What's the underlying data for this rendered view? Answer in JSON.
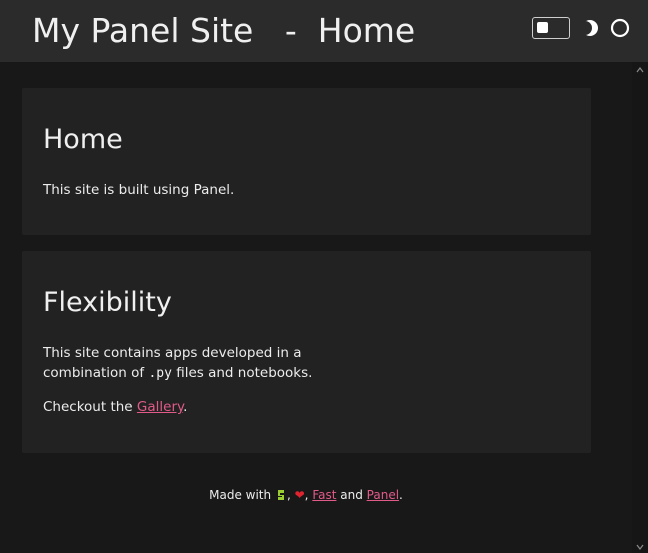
{
  "header": {
    "site_title": "My Panel Site",
    "separator": "-",
    "page_name": "Home"
  },
  "icons": {
    "theme_toggle": "toggle-switch",
    "dark_mode": "moon-icon",
    "light_mode": "sun-icon",
    "python": "python-snake-icon",
    "heart": "heart-icon"
  },
  "cards": [
    {
      "title": "Home",
      "body": "This site is built using Panel."
    },
    {
      "title": "Flexibility",
      "body_pre": "This site contains apps developed in a combination of ",
      "body_code": ".py",
      "body_post": " files and notebooks.",
      "checkout_pre": "Checkout the ",
      "checkout_link": "Gallery",
      "checkout_post": "."
    }
  ],
  "footer": {
    "made_with": "Made with",
    "comma1": ",",
    "comma2": ",",
    "fast_link": "Fast",
    "and": "and",
    "panel_link": "Panel",
    "period": "."
  },
  "colors": {
    "background": "#181818",
    "header_bg": "#2b2b2b",
    "card_bg": "#222222",
    "link": "#e25a8a",
    "heart": "#e0242f",
    "snake": "#9acd32"
  }
}
